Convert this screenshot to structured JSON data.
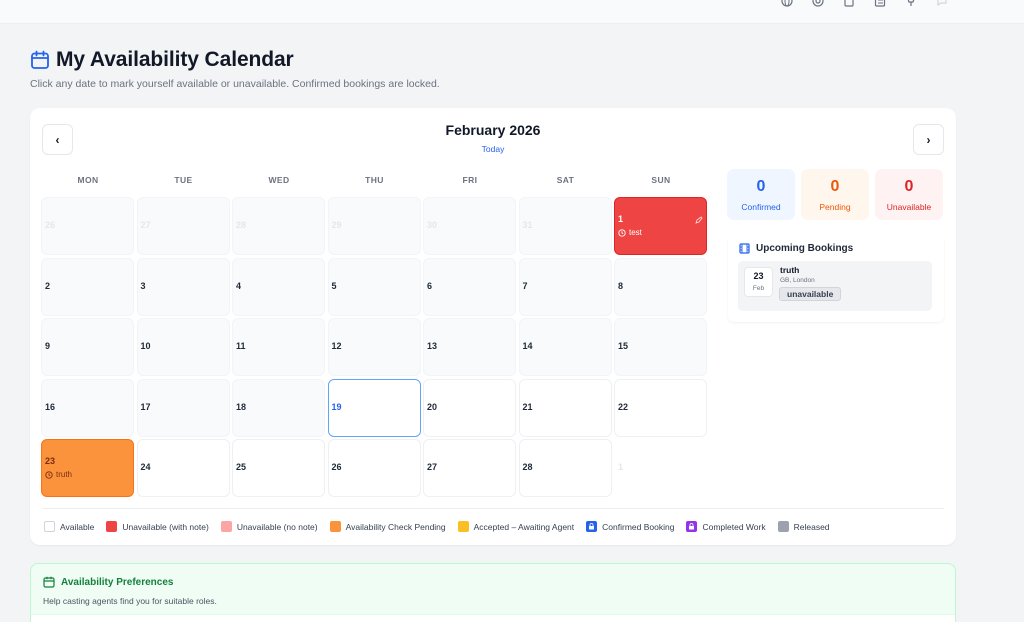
{
  "page": {
    "title": "My Availability Calendar",
    "subtitle": "Click any date to mark yourself available or unavailable. Confirmed bookings are locked."
  },
  "calendar": {
    "month_label": "February 2026",
    "today_label": "Today",
    "prev_label": "‹",
    "next_label": "›",
    "weekdays": [
      "MON",
      "TUE",
      "WED",
      "THU",
      "FRI",
      "SAT",
      "SUN"
    ],
    "days": [
      {
        "n": "26",
        "state": "faded"
      },
      {
        "n": "27",
        "state": "faded"
      },
      {
        "n": "28",
        "state": "faded"
      },
      {
        "n": "29",
        "state": "faded"
      },
      {
        "n": "30",
        "state": "faded"
      },
      {
        "n": "31",
        "state": "faded"
      },
      {
        "n": "1",
        "state": "unavailable",
        "note": "test"
      },
      {
        "n": "2",
        "state": "gray"
      },
      {
        "n": "3",
        "state": "gray"
      },
      {
        "n": "4",
        "state": "gray"
      },
      {
        "n": "5",
        "state": "gray"
      },
      {
        "n": "6",
        "state": "gray"
      },
      {
        "n": "7",
        "state": "gray"
      },
      {
        "n": "8",
        "state": "gray"
      },
      {
        "n": "9",
        "state": "gray"
      },
      {
        "n": "10",
        "state": "gray"
      },
      {
        "n": "11",
        "state": "gray"
      },
      {
        "n": "12",
        "state": "gray"
      },
      {
        "n": "13",
        "state": "gray"
      },
      {
        "n": "14",
        "state": "gray"
      },
      {
        "n": "15",
        "state": "gray"
      },
      {
        "n": "16",
        "state": "gray"
      },
      {
        "n": "17",
        "state": "gray"
      },
      {
        "n": "18",
        "state": "gray"
      },
      {
        "n": "19",
        "state": "today"
      },
      {
        "n": "20",
        "state": "white"
      },
      {
        "n": "21",
        "state": "white"
      },
      {
        "n": "22",
        "state": "white"
      },
      {
        "n": "23",
        "state": "pending",
        "note": "truth"
      },
      {
        "n": "24",
        "state": "white"
      },
      {
        "n": "25",
        "state": "white"
      },
      {
        "n": "26",
        "state": "white"
      },
      {
        "n": "27",
        "state": "white"
      },
      {
        "n": "28",
        "state": "white"
      },
      {
        "n": "1",
        "state": "next-faded"
      }
    ]
  },
  "stats": [
    {
      "value": "0",
      "label": "Confirmed",
      "bg": "#eff6ff",
      "color": "#2563eb"
    },
    {
      "value": "0",
      "label": "Pending",
      "bg": "#fff7ed",
      "color": "#ea580c"
    },
    {
      "value": "0",
      "label": "Unavailable",
      "bg": "#fef2f2",
      "color": "#dc2626"
    }
  ],
  "upcoming": {
    "title": "Upcoming Bookings",
    "items": [
      {
        "day": "23",
        "month": "Feb",
        "name": "truth",
        "location": "GB, London",
        "status": "unavailable"
      }
    ]
  },
  "legend": [
    {
      "label": "Available",
      "color": "#ffffff",
      "border": "#d1d5db",
      "icon": ""
    },
    {
      "label": "Unavailable (with note)",
      "color": "#ef4444",
      "border": "#ef4444",
      "icon": ""
    },
    {
      "label": "Unavailable (no note)",
      "color": "#fca5a5",
      "border": "#fca5a5",
      "icon": ""
    },
    {
      "label": "Availability Check Pending",
      "color": "#fb923c",
      "border": "#fb923c",
      "icon": ""
    },
    {
      "label": "Accepted – Awaiting Agent",
      "color": "#fbbf24",
      "border": "#fbbf24",
      "icon": ""
    },
    {
      "label": "Confirmed Booking",
      "color": "#2563eb",
      "border": "#2563eb",
      "icon": "lock-icon"
    },
    {
      "label": "Completed Work",
      "color": "#9333ea",
      "border": "#9333ea",
      "icon": "lock-icon"
    },
    {
      "label": "Released",
      "color": "#9ca3af",
      "border": "#9ca3af",
      "icon": ""
    }
  ],
  "preferences": {
    "title": "Availability Preferences",
    "subtitle": "Help casting agents find you for suitable roles."
  },
  "colors": {
    "accent": "#2563eb",
    "unavailable": "#ef4444",
    "pending": "#fb923c",
    "prefs_green": "#15803d"
  }
}
